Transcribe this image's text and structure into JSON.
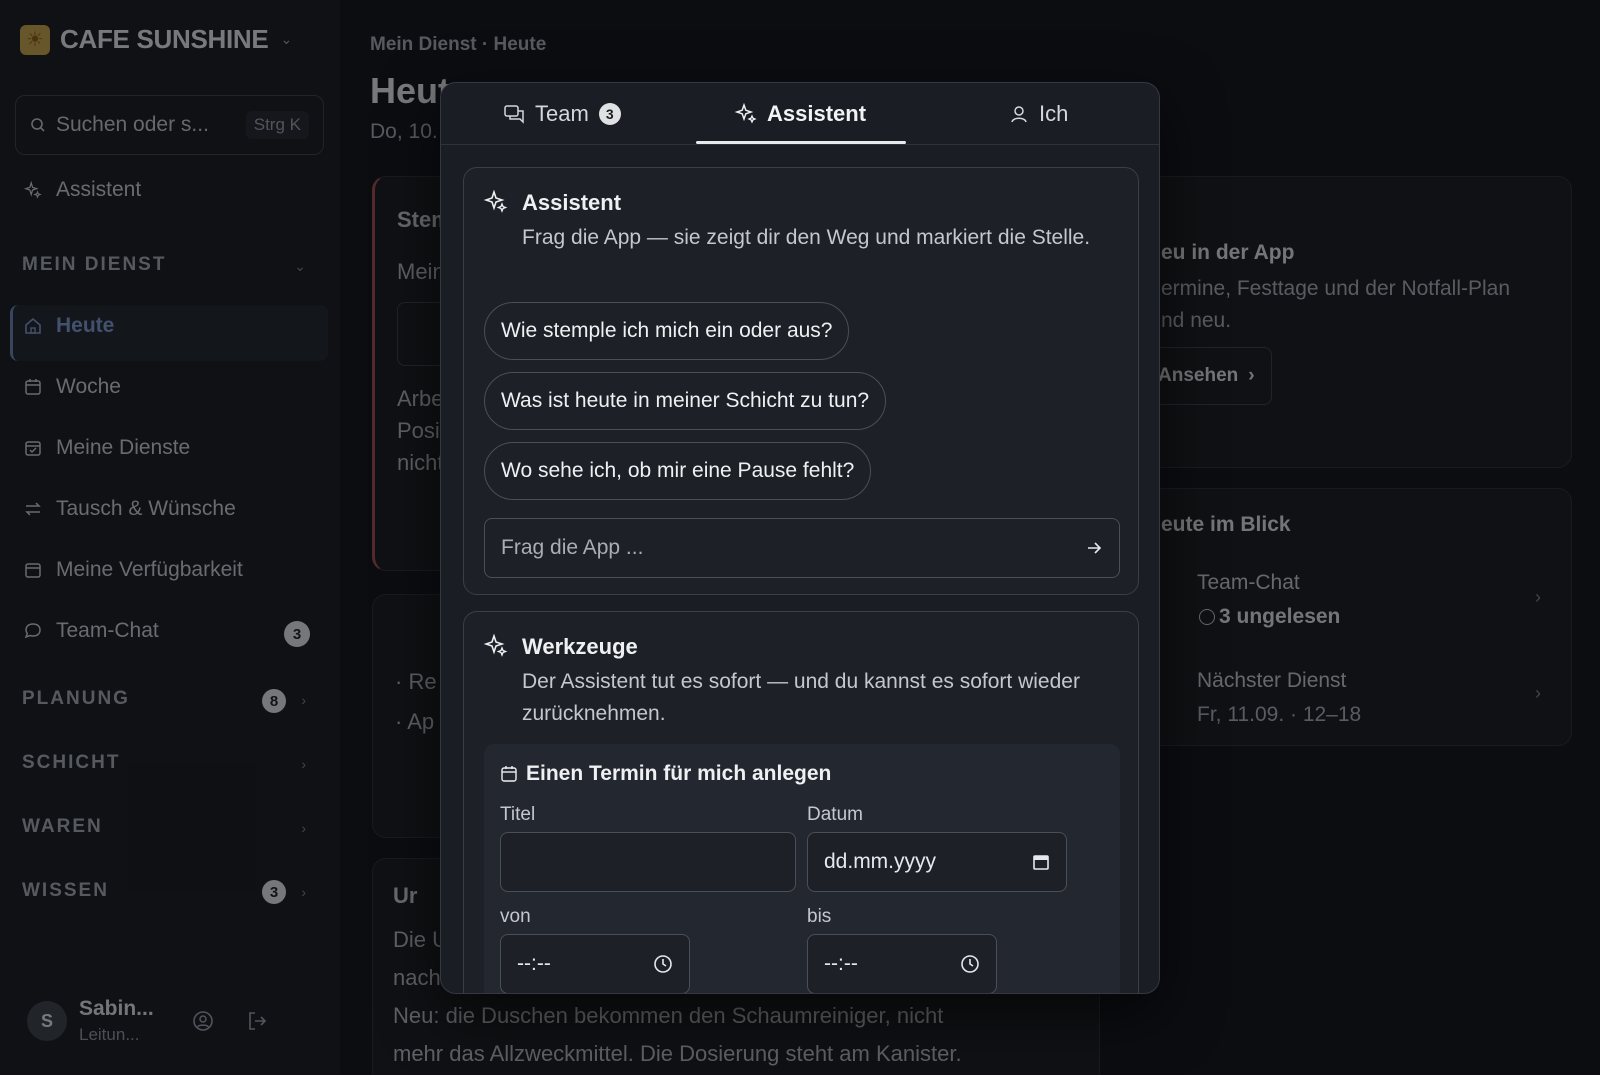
{
  "sidebar": {
    "brand": "CAFE SUNSHINE",
    "search": {
      "placeholder": "Suchen oder s...",
      "shortcut": "Strg K"
    },
    "assistant_label": "Assistent",
    "section_mein_dienst": "MEIN DIENST",
    "items": [
      {
        "label": "Heute",
        "icon": "home-icon"
      },
      {
        "label": "Woche",
        "icon": "calendar-icon"
      },
      {
        "label": "Meine Dienste",
        "icon": "calendar-check-icon"
      },
      {
        "label": "Tausch & Wünsche",
        "icon": "swap-icon"
      },
      {
        "label": "Meine Verfügbarkeit",
        "icon": "calendar-icon"
      },
      {
        "label": "Team-Chat",
        "icon": "chat-icon",
        "badge": "3"
      }
    ],
    "sections": [
      {
        "label": "PLANUNG",
        "badge": "8"
      },
      {
        "label": "SCHICHT"
      },
      {
        "label": "WAREN"
      },
      {
        "label": "WISSEN",
        "badge": "3"
      }
    ],
    "user": {
      "initial": "S",
      "name": "Sabin...",
      "role": "Leitun..."
    }
  },
  "main": {
    "breadcrumb": "Mein Dienst · Heute",
    "title": "Heute",
    "date": "Do, 10.",
    "card1_heading": "Stem",
    "card1_sub": "Mein",
    "card1_lines": [
      "Arbe",
      "Posi",
      "nicht"
    ],
    "card2_lines": [
      "· Re",
      "· Ap"
    ],
    "card3_heading": "Ur",
    "card3_text": [
      "Die U",
      "nach",
      "Neu: die Duschen bekommen den Schaumreiniger, nicht",
      "mehr das Allzweckmittel. Die Dosierung steht am Kanister."
    ],
    "right1": {
      "title": "eu in der App",
      "text": [
        "ermine, Festtage und der Notfall-Plan",
        "nd neu."
      ],
      "button": "Ansehen"
    },
    "right2": {
      "title": "eute im Blick",
      "rows": [
        {
          "title": "Team-Chat",
          "value": "3 ungelesen"
        },
        {
          "title": "Nächster Dienst",
          "value": "Fr, 11.09. · 12–18"
        }
      ]
    }
  },
  "modal": {
    "tabs": [
      {
        "label": "Team",
        "badge": "3",
        "icon": "chat-icon"
      },
      {
        "label": "Assistent",
        "icon": "sparkle-icon",
        "active": true
      },
      {
        "label": "Ich",
        "icon": "user-icon"
      }
    ],
    "assistant": {
      "title": "Assistent",
      "description": "Frag die App — sie zeigt dir den Weg und markiert die Stelle.",
      "suggestions": [
        "Wie stemple ich mich ein oder aus?",
        "Was ist heute in meiner Schicht zu tun?",
        "Wo sehe ich, ob mir eine Pause fehlt?"
      ],
      "input_placeholder": "Frag die App ..."
    },
    "tools": {
      "title": "Werkzeuge",
      "description": "Der Assistent tut es sofort — und du kannst es sofort wieder zurücknehmen.",
      "form": {
        "title": "Einen Termin für mich anlegen",
        "title_label": "Titel",
        "date_label": "Datum",
        "date_placeholder": "dd.mm.yyyy",
        "from_label": "von",
        "to_label": "bis",
        "time_placeholder": "--:--"
      }
    }
  }
}
